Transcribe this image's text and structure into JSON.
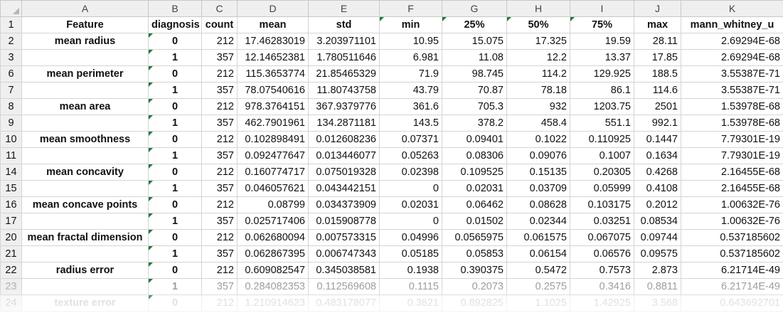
{
  "sheet": {
    "column_letters": [
      "A",
      "B",
      "C",
      "D",
      "E",
      "F",
      "G",
      "H",
      "I",
      "J",
      "K"
    ],
    "header_row_number": "1",
    "headers": [
      "Feature",
      "diagnosis",
      "count",
      "mean",
      "std",
      "min",
      "25%",
      "50%",
      "75%",
      "max",
      "mann_whitney_u"
    ],
    "rows": [
      {
        "row": "2",
        "feature": "mean radius",
        "diagnosis": "0",
        "values": [
          "212",
          "17.46283019",
          "3.203971101",
          "10.95",
          "15.075",
          "17.325",
          "19.59",
          "28.11",
          "2.69294E-68"
        ]
      },
      {
        "row": "3",
        "feature": "",
        "diagnosis": "1",
        "values": [
          "357",
          "12.14652381",
          "1.780511646",
          "6.981",
          "11.08",
          "12.2",
          "13.37",
          "17.85",
          "2.69294E-68"
        ]
      },
      {
        "row": "6",
        "feature": "mean perimeter",
        "diagnosis": "0",
        "values": [
          "212",
          "115.3653774",
          "21.85465329",
          "71.9",
          "98.745",
          "114.2",
          "129.925",
          "188.5",
          "3.55387E-71"
        ]
      },
      {
        "row": "7",
        "feature": "",
        "diagnosis": "1",
        "values": [
          "357",
          "78.07540616",
          "11.80743758",
          "43.79",
          "70.87",
          "78.18",
          "86.1",
          "114.6",
          "3.55387E-71"
        ]
      },
      {
        "row": "8",
        "feature": "mean area",
        "diagnosis": "0",
        "values": [
          "212",
          "978.3764151",
          "367.9379776",
          "361.6",
          "705.3",
          "932",
          "1203.75",
          "2501",
          "1.53978E-68"
        ]
      },
      {
        "row": "9",
        "feature": "",
        "diagnosis": "1",
        "values": [
          "357",
          "462.7901961",
          "134.2871181",
          "143.5",
          "378.2",
          "458.4",
          "551.1",
          "992.1",
          "1.53978E-68"
        ]
      },
      {
        "row": "10",
        "feature": "mean smoothness",
        "diagnosis": "0",
        "values": [
          "212",
          "0.102898491",
          "0.012608236",
          "0.07371",
          "0.09401",
          "0.1022",
          "0.110925",
          "0.1447",
          "7.79301E-19"
        ]
      },
      {
        "row": "11",
        "feature": "",
        "diagnosis": "1",
        "values": [
          "357",
          "0.092477647",
          "0.013446077",
          "0.05263",
          "0.08306",
          "0.09076",
          "0.1007",
          "0.1634",
          "7.79301E-19"
        ]
      },
      {
        "row": "14",
        "feature": "mean concavity",
        "diagnosis": "0",
        "values": [
          "212",
          "0.160774717",
          "0.075019328",
          "0.02398",
          "0.109525",
          "0.15135",
          "0.20305",
          "0.4268",
          "2.16455E-68"
        ]
      },
      {
        "row": "15",
        "feature": "",
        "diagnosis": "1",
        "values": [
          "357",
          "0.046057621",
          "0.043442151",
          "0",
          "0.02031",
          "0.03709",
          "0.05999",
          "0.4108",
          "2.16455E-68"
        ]
      },
      {
        "row": "16",
        "feature": "mean concave points",
        "diagnosis": "0",
        "values": [
          "212",
          "0.08799",
          "0.034373909",
          "0.02031",
          "0.06462",
          "0.08628",
          "0.103175",
          "0.2012",
          "1.00632E-76"
        ]
      },
      {
        "row": "17",
        "feature": "",
        "diagnosis": "1",
        "values": [
          "357",
          "0.025717406",
          "0.015908778",
          "0",
          "0.01502",
          "0.02344",
          "0.03251",
          "0.08534",
          "1.00632E-76"
        ]
      },
      {
        "row": "20",
        "feature": "mean fractal dimension",
        "diagnosis": "0",
        "values": [
          "212",
          "0.062680094",
          "0.007573315",
          "0.04996",
          "0.0565975",
          "0.061575",
          "0.067075",
          "0.09744",
          "0.537185602"
        ]
      },
      {
        "row": "21",
        "feature": "",
        "diagnosis": "1",
        "values": [
          "357",
          "0.062867395",
          "0.006747343",
          "0.05185",
          "0.05853",
          "0.06154",
          "0.06576",
          "0.09575",
          "0.537185602"
        ]
      },
      {
        "row": "22",
        "feature": "radius error",
        "diagnosis": "0",
        "values": [
          "212",
          "0.609082547",
          "0.345038581",
          "0.1938",
          "0.390375",
          "0.5472",
          "0.7573",
          "2.873",
          "6.21714E-49"
        ]
      },
      {
        "row": "23",
        "feature": "",
        "diagnosis": "1",
        "values": [
          "357",
          "0.284082353",
          "0.112569608",
          "0.1115",
          "0.2073",
          "0.2575",
          "0.3416",
          "0.8811",
          "6.21714E-49"
        ]
      },
      {
        "row": "24",
        "feature": "texture error",
        "diagnosis": "0",
        "values": [
          "212",
          "1.210914623",
          "0.483178077",
          "0.3621",
          "0.892825",
          "1.1025",
          "1.42925",
          "3.568",
          "0.643692701"
        ]
      }
    ]
  },
  "colors": {
    "header_bg": "#efefef",
    "grid_line": "#d4d4d4",
    "flag_green": "#1e7a3c"
  }
}
